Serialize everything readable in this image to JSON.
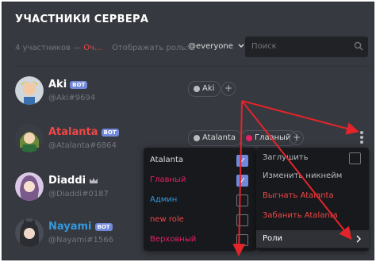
{
  "header": {
    "title": "УЧАСТНИКИ СЕРВЕРА"
  },
  "filters": {
    "count_text": "4 участников —",
    "clear_text": "Оч...",
    "show_role_label": "Отображать роль:",
    "role_select": "@everyone",
    "search_placeholder": "Поиск"
  },
  "members": [
    {
      "name": "Aki",
      "badge": "BOT",
      "tag": "@Aki#9694",
      "name_color": "#ffffff"
    },
    {
      "name": "Atalanta",
      "badge": "BOT",
      "tag": "@Atalanta#6864",
      "name_color": "#f04747"
    },
    {
      "name": "Diaddi",
      "badge": "",
      "tag": "@Diaddi#0187",
      "name_color": "#ffffff"
    },
    {
      "name": "Nayami",
      "badge": "BOT",
      "tag": "@Nayami#1566",
      "name_color": "#3498db"
    }
  ],
  "member_roles": {
    "aki": [
      {
        "label": "Aki",
        "color": "#b9bbbe"
      }
    ],
    "atalanta": [
      {
        "label": "Atalanta",
        "color": "#b9bbbe"
      },
      {
        "label": "Главный",
        "color": "#e91e63"
      }
    ]
  },
  "roles_menu": [
    {
      "label": "Atalanta",
      "color": "#dcddde",
      "checked": true
    },
    {
      "label": "Главный",
      "color": "#e91e63",
      "checked": true
    },
    {
      "label": "Админ",
      "color": "#3498db",
      "checked": false
    },
    {
      "label": "new role",
      "color": "#f04747",
      "checked": false
    },
    {
      "label": "Верховный",
      "color": "#e91e63",
      "checked": false
    }
  ],
  "context_menu": {
    "mute": "Заглушить",
    "nickname": "Изменить никнейм",
    "kick": "Выгнать Atalanta",
    "ban": "Забанить Atalanta",
    "roles": "Роли"
  },
  "colors": {
    "accent": "#7289da",
    "danger": "#f04747",
    "arrow": "#e3242b"
  }
}
